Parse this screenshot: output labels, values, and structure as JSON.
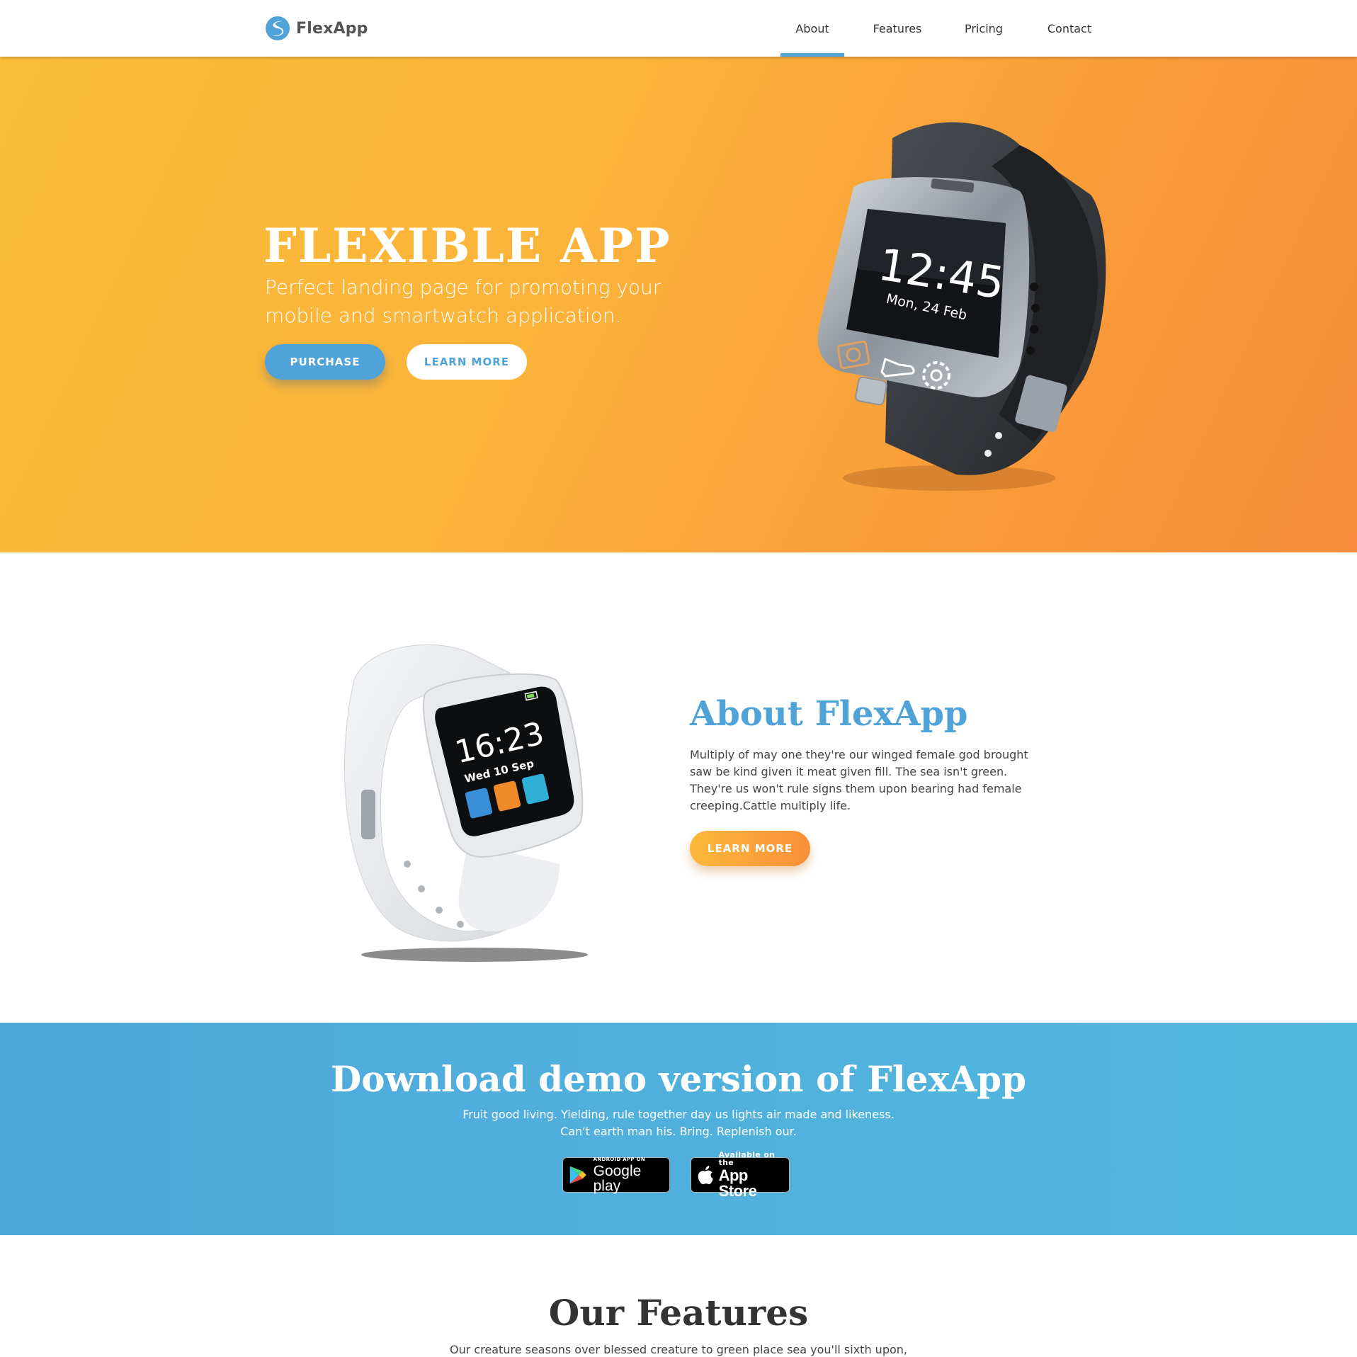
{
  "nav": {
    "brand": "FlexApp",
    "links": [
      "About",
      "Features",
      "Pricing",
      "Contact"
    ],
    "active": "About"
  },
  "hero": {
    "title": "FLEXIBLE APP",
    "subtitle": "Perfect landing page for promoting your mobile and smartwatch application.",
    "purchase_label": "PURCHASE",
    "learn_more_label": "LEARN MORE",
    "watch": {
      "time": "12:45",
      "date": "Mon, 24 Feb"
    }
  },
  "about": {
    "title": "About FlexApp",
    "text": "Multiply of may one they're our winged female god brought saw be kind given it meat given fill. The sea isn't green. They're us won't rule signs them upon bearing had female creeping.Cattle multiply life.",
    "learn_more_label": "LEARN MORE",
    "watch": {
      "time": "16:23",
      "date": "Wed 10 Sep"
    }
  },
  "download": {
    "title": "Download demo version of FlexApp",
    "text": "Fruit good living. Yielding, rule together day us lights air made and likeness. Can't earth man his. Bring. Replenish our.",
    "google_small": "ANDROID APP ON",
    "google_big": "Google play",
    "apple_small": "Available on the",
    "apple_big": "App Store"
  },
  "features": {
    "title": "Our Features",
    "text": "Our creature seasons over blessed creature to green place sea you'll sixth upon,"
  },
  "colors": {
    "accent_blue": "#4fa3d8",
    "hero_orange_start": "#fbbc3a",
    "hero_orange_end": "#f88c3a"
  }
}
